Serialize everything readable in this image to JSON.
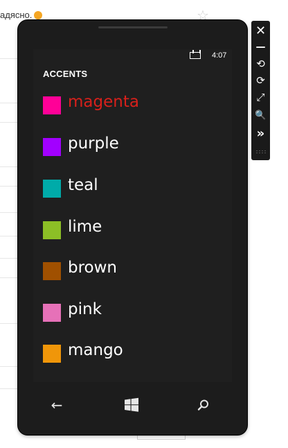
{
  "background": {
    "snippet_text": "адясно.",
    "star_glyph": "☆"
  },
  "status_bar": {
    "time": "4:07"
  },
  "page": {
    "title": "ACCENTS"
  },
  "accents": [
    {
      "label": "magenta",
      "color": "#ff0097",
      "selected": true
    },
    {
      "label": "purple",
      "color": "#a200ff",
      "selected": false
    },
    {
      "label": "teal",
      "color": "#00aba9",
      "selected": false
    },
    {
      "label": "lime",
      "color": "#8cbf26",
      "selected": false
    },
    {
      "label": "brown",
      "color": "#a05000",
      "selected": false
    },
    {
      "label": "pink",
      "color": "#e671b8",
      "selected": false
    },
    {
      "label": "mango",
      "color": "#f09609",
      "selected": false
    }
  ],
  "theme": {
    "selected_text_color": "#d8201b"
  },
  "nav": {
    "back_glyph": "←",
    "search_glyph": "⌕"
  },
  "toolbar": {
    "close_glyph": "✕",
    "minimize_glyph": "—",
    "rotate_left_glyph": "⟲",
    "rotate_right_glyph": "⟳",
    "fit_glyph": "⤢",
    "zoom_glyph": "🔍",
    "more_glyph": "»"
  }
}
